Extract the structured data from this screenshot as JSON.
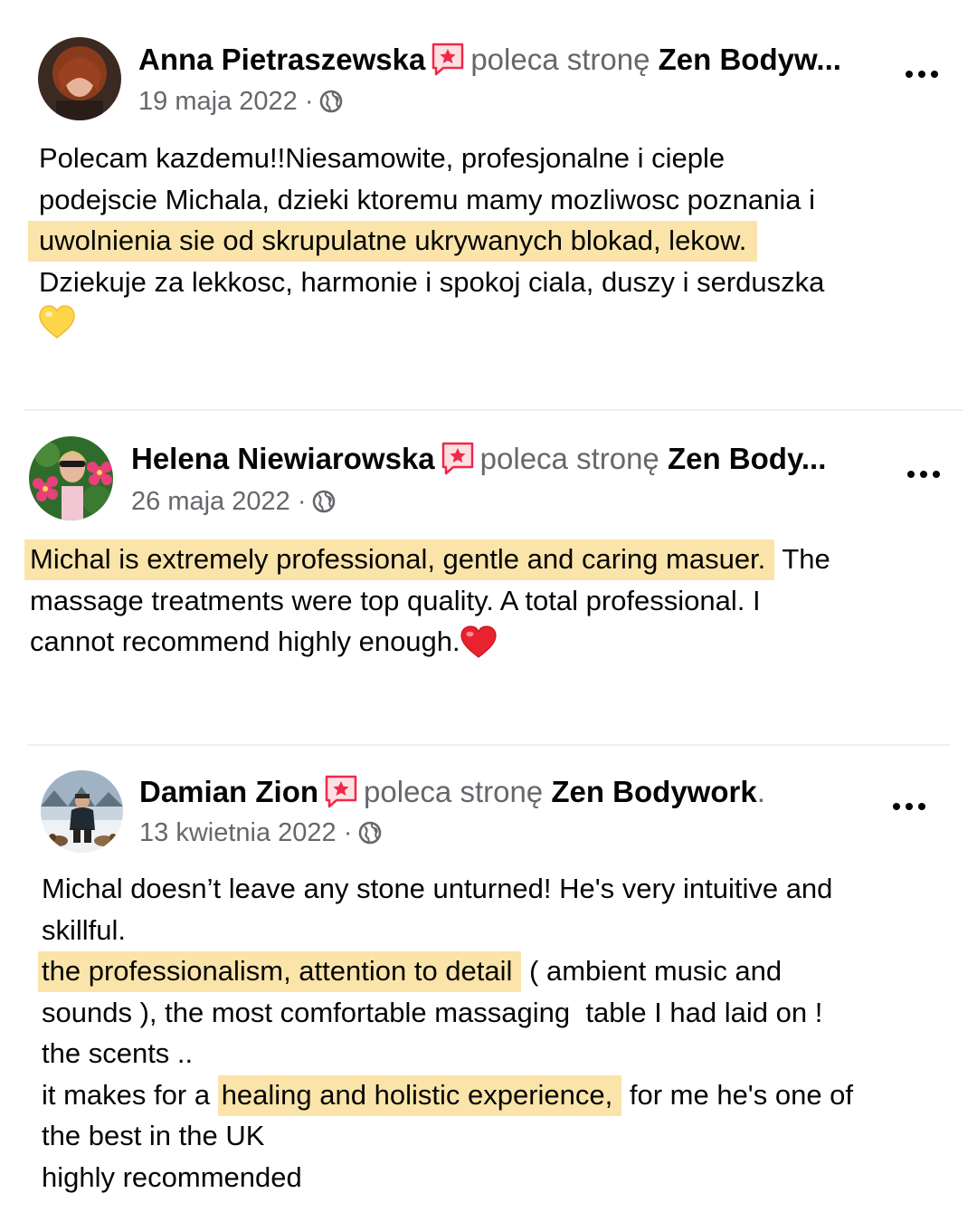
{
  "reviews": [
    {
      "author": "Anna Pietraszewska",
      "action": "poleca stronę",
      "page": "Zen Bodyw...",
      "date": "19 maja 2022",
      "separator": "·",
      "lines": [
        "Polecam kazdemu!!Niesamowite, profesjonalne i cieple",
        "podejscie Michala, dzieki ktoremu mamy mozliwosc poznania i",
        "uwolnienia sie od skrupulatne ukrywanych blokad, lekow.",
        "Dziekuje za lekkosc, harmonie i spokoj ciala, duszy i serduszka"
      ],
      "emoji": "yellow-heart"
    },
    {
      "author": "Helena Niewiarowska",
      "action": "poleca stronę",
      "page": "Zen Body...",
      "date": "26 maja 2022",
      "separator": "·",
      "highlight": "Michal is extremely professional, gentle and caring masuer.",
      "after_highlight": " The",
      "lines": [
        "massage treatments were top quality. A total professional. I",
        "cannot recommend highly enough."
      ],
      "emoji": "red-heart"
    },
    {
      "author": "Damian Zion",
      "action": "poleca stronę",
      "page": "Zen Bodywork",
      "page_suffix": ".",
      "date": "13 kwietnia 2022",
      "separator": "·",
      "lines": [
        "Michal doesn’t leave any stone unturned! He's very intuitive and",
        "skillful.",
        "the professionalism, attention to detail",
        " ( ambient music and",
        "sounds ), the most comfortable massaging  table I had laid on !",
        "the scents ..",
        "it makes for a ",
        "healing and holistic experience,",
        " for me he's one of",
        "the best in the UK",
        "highly recommended"
      ]
    }
  ],
  "colors": {
    "highlight": "#fbe4a9",
    "secondary_text": "#65676b",
    "recommend_icon": "#f02849"
  },
  "icons": [
    "recommend-icon",
    "globe-icon",
    "more-options-icon"
  ]
}
